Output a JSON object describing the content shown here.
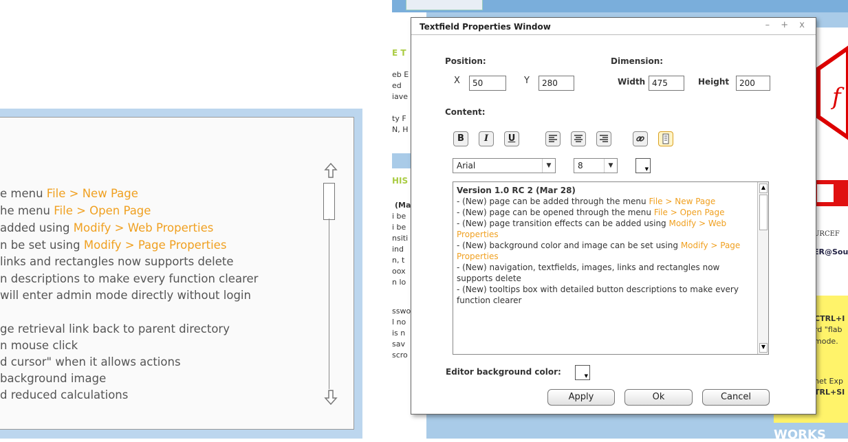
{
  "zoom_panel": {
    "lines": [
      {
        "pre": "e menu ",
        "hl": "File > New Page",
        "top": 0
      },
      {
        "pre": "he menu ",
        "hl": "File > Open Page",
        "top": 0
      },
      {
        "pre": "added using ",
        "hl": "Modify > Web Properties",
        "top": 0
      },
      {
        "pre": "n be set using ",
        "hl": "Modify > Page Properties",
        "top": 0
      },
      {
        "pre": " links and rectangles now supports delete",
        "hl": "",
        "top": 0
      },
      {
        "pre": "n descriptions to make every function clearer",
        "hl": "",
        "top": 0
      },
      {
        "pre": " will enter admin mode directly without login",
        "hl": "",
        "top": 0
      },
      {
        "pre": "ge retrieval link back to parent directory",
        "hl": "",
        "top": 0
      },
      {
        "pre": "n mouse click",
        "hl": "",
        "top": 0
      },
      {
        "pre": "d cursor\" when it allows actions",
        "hl": "",
        "top": 0
      },
      {
        "pre": " background image",
        "hl": "",
        "top": 0
      },
      {
        "pre": "d reduced calculations",
        "hl": "",
        "top": 0
      }
    ]
  },
  "background": {
    "tab_label": "",
    "fragments": [
      "E T",
      "eb E",
      "ed",
      "iave",
      "ty F",
      "N, H",
      "HIS",
      "(Ma",
      "i be",
      "i be",
      "nsiti",
      "ind",
      "n, t",
      "oox",
      "n lo",
      "sswo",
      "l no",
      "is n",
      "sav",
      "scro",
      "CTRL+I",
      "rd \"flab",
      "mode.",
      "net Exp",
      "TRL+SI",
      "ER@Sou",
      "URCEF",
      "WORKS"
    ]
  },
  "dialog": {
    "title": "Textfield Properties Window",
    "controls": "– + x",
    "position_label": "Position:",
    "dimension_label": "Dimension:",
    "x_label": "X",
    "x_value": "50",
    "y_label": "Y",
    "y_value": "280",
    "width_label": "Width",
    "width_value": "475",
    "height_label": "Height",
    "height_value": "200",
    "content_label": "Content:",
    "toolbar": {
      "bold": "B",
      "italic": "I",
      "underline": "U"
    },
    "font_family": "Arial",
    "font_size": "8",
    "content_lines": [
      {
        "pre": "Version 1.0 RC 2 (Mar 28)",
        "hl": "",
        "post": "",
        "bold": true
      },
      {
        "pre": "- (New) page can be added through the menu ",
        "hl": "File > New Page",
        "post": ""
      },
      {
        "pre": "- (New) page can be opened through the menu ",
        "hl": "File > Open Page",
        "post": ""
      },
      {
        "pre": "- (New) page transition effects can be added using ",
        "hl": "Modify > Web Properties",
        "post": ""
      },
      {
        "pre": "- (New) background color and image can be set using ",
        "hl": "Modify > Page Properties",
        "post": ""
      },
      {
        "pre": "- (New) navigation, textfields, images, links and rectangles now supports delete",
        "hl": "",
        "post": ""
      },
      {
        "pre": "- (New) tooltips box with detailed button descriptions to make every function clearer",
        "hl": "",
        "post": ""
      }
    ],
    "editor_bg_label": "Editor background color:",
    "apply_label": "Apply",
    "ok_label": "Ok",
    "cancel_label": "Cancel"
  }
}
